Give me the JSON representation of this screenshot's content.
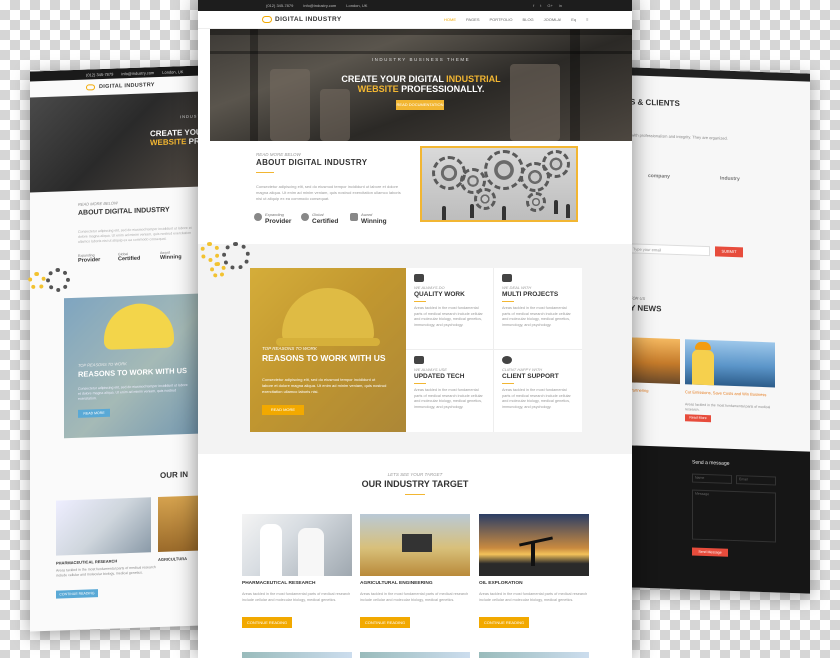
{
  "colors": {
    "accent": "#f2a900",
    "accent_light": "#f2b632",
    "dark": "#1d1d1d",
    "red_button": "#e74c3c",
    "blue_button": "#5aa9d6"
  },
  "center": {
    "topbar": {
      "phone": "(012) 345-7879",
      "email": "info@industry.com",
      "location": "London, UK"
    },
    "social_icons": [
      "facebook-icon",
      "twitter-icon",
      "google-plus-icon",
      "linkedin-icon"
    ],
    "brand": "DIGITAL INDUSTRY",
    "nav": [
      "HOME",
      "PAGES",
      "PORTFOLIO",
      "BLOG",
      "JOOMLA!",
      "Eq",
      "≡"
    ],
    "hero": {
      "pretitle": "INDUSTRY BUSINESS THEME",
      "title_line1_prefix": "CREATE YOUR DIGITAL ",
      "title_line1_highlight": "INDUSTRIAL",
      "title_line2_highlight": "WEBSITE",
      "title_line2_suffix": " PROFESSIONALLY.",
      "button": "READ DOCUMENTATION"
    },
    "about": {
      "pretitle": "READ MORE BELOW",
      "title": "ABOUT DIGITAL INDUSTRY",
      "text": "Consectetur adipiscing elit, sed do eiusmod tempor incididunt ut labore et dolore magna aliqua. Ut enim ad minim veniam, quis nostrud exercitation ullamco laboris nisi ut aliquip ex ea commodo consequat.",
      "features": [
        {
          "pre": "Expanding",
          "label": "Provider"
        },
        {
          "pre": "Global",
          "label": "Certified"
        },
        {
          "pre": "Award",
          "label": "Winning"
        }
      ]
    },
    "reasons": {
      "pretitle": "TOP REASONS TO WORK",
      "title": "REASONS TO WORK WITH US",
      "text": "Consectetur adipiscing elit, sed do eiusmod tempor incididunt ut labore et dolore magna aliqua. Ut enim ad minim veniam, quis nostrud exercitation ullamco laboris nisi.",
      "button": "READ MORE"
    },
    "services": [
      {
        "pre": "WE ALWAYS DO",
        "title": "QUALITY WORK",
        "icon": "heart-pulse-icon",
        "text": "Areas tackled in the most fundamental parts of medical research include cellular and molecular biology, medical genetics, immunology, and psychology."
      },
      {
        "pre": "WE DEAL WITH",
        "title": "MULTI PROJECTS",
        "icon": "link-icon",
        "text": "Areas tackled in the most fundamental parts of medical research include cellular and molecular biology, medical genetics, immunology, and psychology."
      },
      {
        "pre": "WE ALWAYS USE",
        "title": "UPDATED TECH",
        "icon": "area-chart-icon",
        "text": "Areas tackled in the most fundamental parts of medical research include cellular and molecular biology, medical genetics, immunology, and psychology."
      },
      {
        "pre": "CLIENT HAPPY WITH",
        "title": "CLIENT SUPPORT",
        "icon": "lifebuoy-icon",
        "text": "Areas tackled in the most fundamental parts of medical research include cellular and molecular biology, medical genetics, immunology, and psychology."
      }
    ],
    "target": {
      "pretitle": "LETS SEE YOUR TARGET",
      "title": "OUR INDUSTRY TARGET",
      "cards": [
        {
          "title": "PHARMACEUTICAL RESEARCH",
          "text": "Areas tackled in the most fundamental parts of medical research include cellular and molecular biology, medical genetics.",
          "button": "CONTINUE READING"
        },
        {
          "title": "AGRICULTURAL ENGINEERING",
          "text": "Areas tackled in the most fundamental parts of medical research include cellular and molecular biology, medical genetics.",
          "button": "CONTINUE READING"
        },
        {
          "title": "OIL EXPLORATION",
          "text": "Areas tackled in the most fundamental parts of medical research include cellular and molecular biology, medical genetics.",
          "button": "CONTINUE READING"
        }
      ]
    }
  },
  "left": {
    "topbar": {
      "phone": "(012) 345-7879",
      "email": "info@industry.com",
      "location": "London, UK"
    },
    "brand": "DIGITAL INDUSTRY",
    "hero": {
      "pretitle": "INDUSTRY",
      "title_line1": "CREATE YOUR",
      "title_line2_highlight": "WEBSITE",
      "title_line2_suffix": " PROFES"
    },
    "about": {
      "pretitle": "READ MORE BELOW",
      "title": "ABOUT DIGITAL INDUSTRY",
      "text": "Consectetur adipiscing elit, sed do eiusmod tempor incididunt ut labore et dolore magna aliqua. Ut enim ad minim veniam, quis nostrud exercitation ullamco laboris nisi ut aliquip ex ea commodo consequat.",
      "features": [
        {
          "pre": "Expanding",
          "label": "Provider"
        },
        {
          "pre": "Global",
          "label": "Certified"
        },
        {
          "pre": "Award",
          "label": "Winning"
        }
      ]
    },
    "reasons": {
      "pretitle": "TOP REASONS TO WORK",
      "title": "REASONS TO WORK WITH US",
      "text": "Consectetur adipiscing elit, sed do eiusmod tempor incididunt ut labore et dolore magna aliqua. Ut enim ad minim veniam, quis nostrud exercitation.",
      "button": "READ MORE"
    },
    "target_title": "OUR IN",
    "cards": [
      {
        "title": "PHARMACEUTICAL RESEARCH",
        "text": "Areas tackled in the most fundamental parts of medical research include cellular and molecular biology, medical genetics.",
        "button": "CONTINUE READING"
      },
      {
        "title": "AGRICULTURA",
        "text": "Areas tackled in the most fundamental parts of medical research include cellular and molecular biology.",
        "button": "CONTINUE READING"
      }
    ]
  },
  "right": {
    "clients_title": "S & CLIENTS",
    "clients_text": "...s with professionalism and integrity. They are organized.",
    "logos": [
      "company",
      "Industry"
    ],
    "subscribe_placeholder": "Type your email",
    "submit": "SUBMIT",
    "news_pre": "FOR US",
    "news_title": "Y NEWS",
    "news_captions": [
      "Partnering",
      "Cut Emissions, Save Costs and Win Business"
    ],
    "news_desc": "Areas tackled in the most fundamental parts of medical research.",
    "read_more": "Read More",
    "contact_title": "Send a message",
    "contact_fields": [
      "Name",
      "Email",
      "Message"
    ],
    "send_button": "Send Message"
  }
}
